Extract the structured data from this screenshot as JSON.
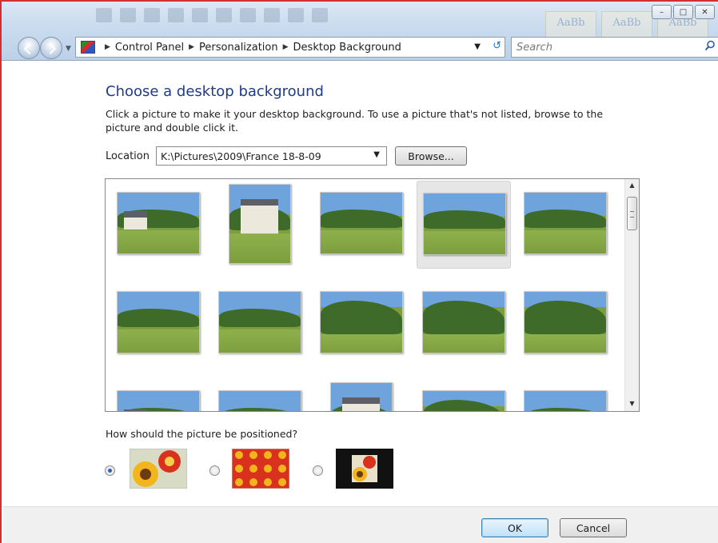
{
  "window": {
    "controls": {
      "minimize": "–",
      "maximize": "□",
      "close": "✕"
    }
  },
  "address": {
    "breadcrumbs": [
      "Control Panel",
      "Personalization",
      "Desktop Background"
    ],
    "search_placeholder": "Search"
  },
  "page": {
    "title": "Choose a desktop background",
    "description": "Click a picture to make it your desktop background. To use a picture that's not listed, browse to the picture and double click it."
  },
  "location": {
    "label": "Location",
    "value": "K:\\Pictures\\2009\\France 18-8-09",
    "browse_label": "Browse..."
  },
  "gallery": {
    "selected_index": 3,
    "pictures": [
      {
        "name": "house-driveway",
        "kind": "house"
      },
      {
        "name": "white-house-portrait",
        "kind": "tall-house"
      },
      {
        "name": "garden-lawn-1",
        "kind": "garden"
      },
      {
        "name": "garden-lawn-2",
        "kind": "garden"
      },
      {
        "name": "orchard-tree",
        "kind": "tree"
      },
      {
        "name": "orchard-lawn",
        "kind": "tree"
      },
      {
        "name": "flowerbed-trees",
        "kind": "garden"
      },
      {
        "name": "hedge-corner",
        "kind": "hedge"
      },
      {
        "name": "palm-garden",
        "kind": "hedge"
      },
      {
        "name": "topiary-lawn",
        "kind": "hedge"
      },
      {
        "name": "house-roof-partial",
        "kind": "house"
      },
      {
        "name": "hedge-partial",
        "kind": "garden"
      },
      {
        "name": "gable-house",
        "kind": "tall-house"
      },
      {
        "name": "dark-hedge-partial",
        "kind": "hedge"
      },
      {
        "name": "flowers-partial",
        "kind": "flowers"
      }
    ]
  },
  "position": {
    "label": "How should the picture be positioned?",
    "options": [
      {
        "name": "fill",
        "selected": true
      },
      {
        "name": "tile",
        "selected": false
      },
      {
        "name": "center",
        "selected": false
      }
    ]
  },
  "footer": {
    "ok_label": "OK",
    "cancel_label": "Cancel"
  },
  "colors": {
    "title_blue": "#1e3b8b",
    "frame_red": "#d03030",
    "sky": "#6fa3dc",
    "grass": "#7d9e3e",
    "foliage": "#3f6b2a"
  }
}
